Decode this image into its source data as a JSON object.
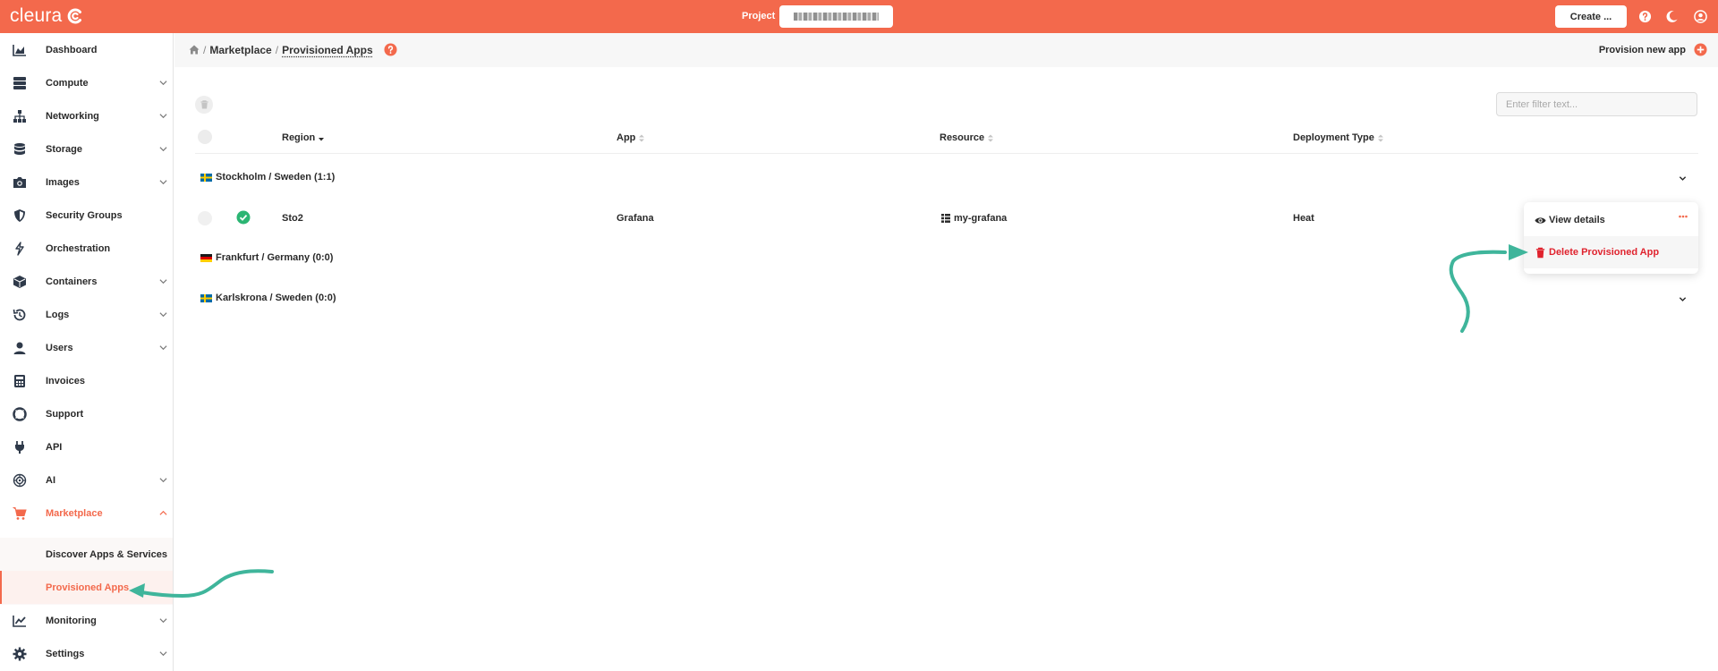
{
  "brand": {
    "name": "cleura",
    "accent": "#f3694c"
  },
  "topbar": {
    "project_label": "Project",
    "create_label": "Create ..."
  },
  "sidebar": {
    "items": [
      {
        "label": "Dashboard",
        "icon": "chart-area-icon",
        "expandable": false
      },
      {
        "label": "Compute",
        "icon": "server-icon",
        "expandable": true
      },
      {
        "label": "Networking",
        "icon": "network-icon",
        "expandable": true
      },
      {
        "label": "Storage",
        "icon": "database-icon",
        "expandable": true
      },
      {
        "label": "Images",
        "icon": "camera-icon",
        "expandable": true
      },
      {
        "label": "Security Groups",
        "icon": "shield-icon",
        "expandable": false
      },
      {
        "label": "Orchestration",
        "icon": "orchestration-icon",
        "expandable": false
      },
      {
        "label": "Containers",
        "icon": "cube-icon",
        "expandable": true
      },
      {
        "label": "Logs",
        "icon": "history-icon",
        "expandable": true
      },
      {
        "label": "Users",
        "icon": "user-icon",
        "expandable": true
      },
      {
        "label": "Invoices",
        "icon": "calculator-icon",
        "expandable": false
      },
      {
        "label": "Support",
        "icon": "lifebuoy-icon",
        "expandable": false
      },
      {
        "label": "API",
        "icon": "plug-icon",
        "expandable": false
      },
      {
        "label": "AI",
        "icon": "ai-icon",
        "expandable": true
      },
      {
        "label": "Marketplace",
        "icon": "cart-icon",
        "expandable": true,
        "active": true
      },
      {
        "label": "Monitoring",
        "icon": "chart-line-icon",
        "expandable": true
      },
      {
        "label": "Settings",
        "icon": "gear-icon",
        "expandable": true
      }
    ],
    "marketplace_sub": [
      {
        "label": "Discover Apps & Services"
      },
      {
        "label": "Provisioned Apps",
        "selected": true
      }
    ]
  },
  "header": {
    "breadcrumb": [
      "Marketplace",
      "Provisioned Apps"
    ],
    "provision_label": "Provision new app"
  },
  "filter": {
    "placeholder": "Enter filter text..."
  },
  "table": {
    "columns": [
      "Region",
      "App",
      "Resource",
      "Deployment Type"
    ],
    "groups": [
      {
        "label": "Stockholm / Sweden",
        "count": "(1:1)",
        "flag": "sweden-flag-icon"
      },
      {
        "label": "Frankfurt / Germany",
        "count": "(0:0)",
        "flag": "germany-flag-icon"
      },
      {
        "label": "Karlskrona / Sweden",
        "count": "(0:0)",
        "flag": "sweden-flag-icon"
      }
    ],
    "rows": [
      {
        "region": "Sto2",
        "app": "Grafana",
        "resource": "my-grafana",
        "deployment_type": "Heat",
        "status": "ok"
      }
    ]
  },
  "context_menu": {
    "view_label": "View details",
    "delete_label": "Delete Provisioned App",
    "danger_color": "#e0232e"
  },
  "annotation_color": "#3fb59b"
}
